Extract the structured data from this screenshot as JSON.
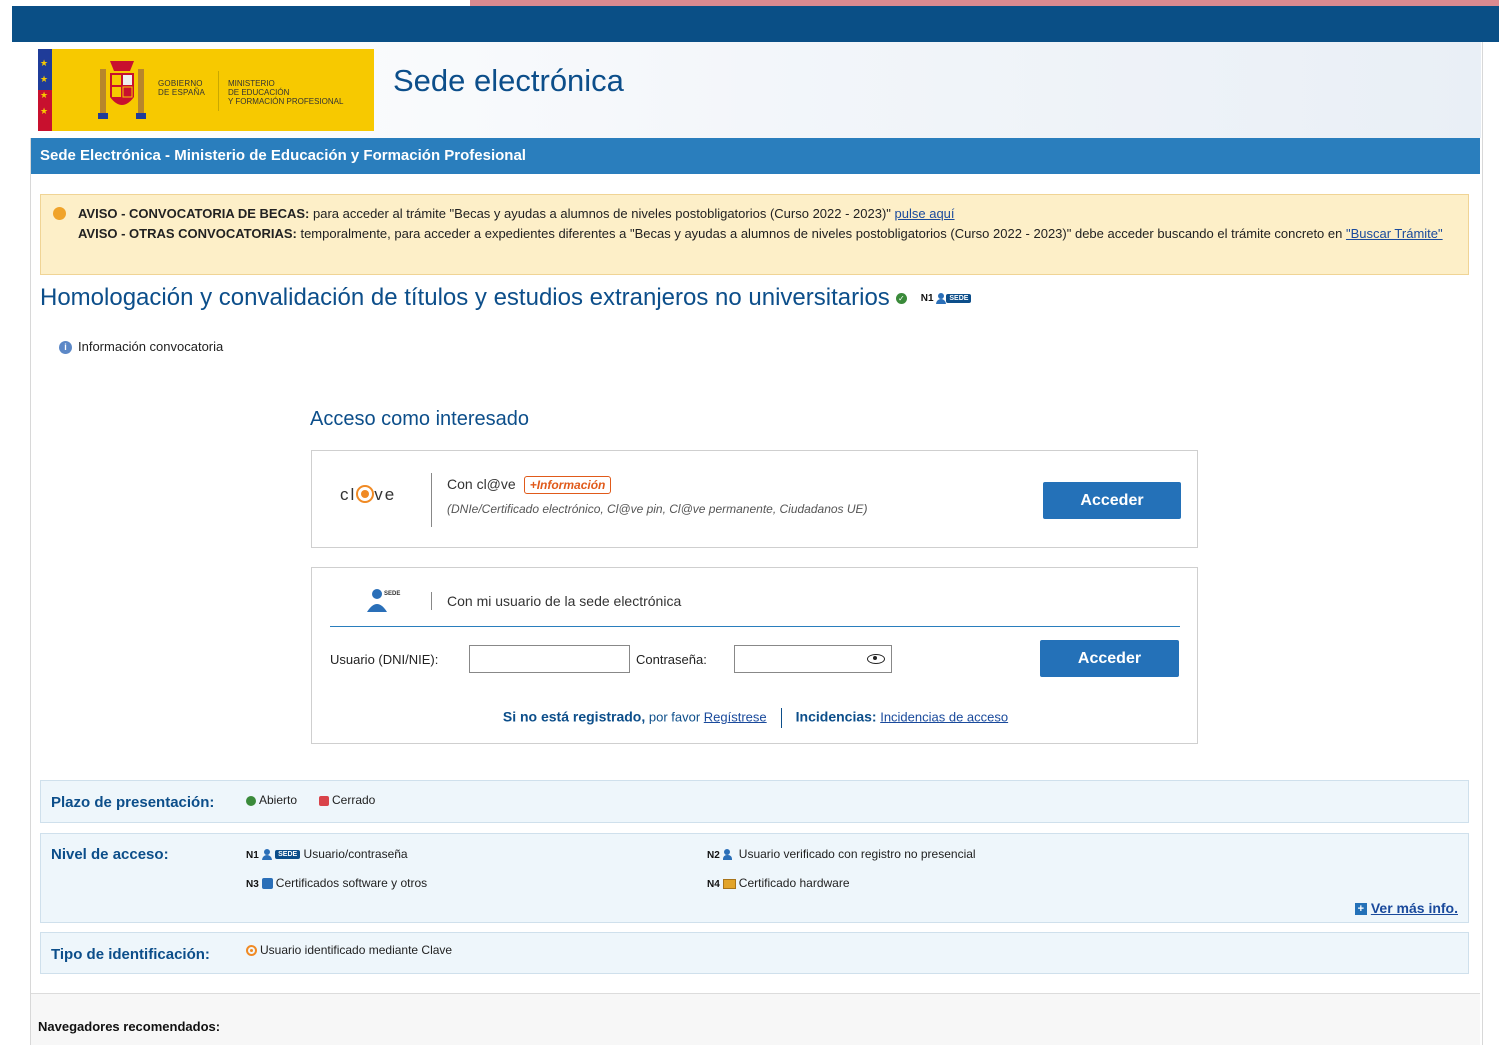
{
  "header": {
    "site_title": "Sede electrónica",
    "logo_gobierno": "GOBIERNO\nDE ESPAÑA",
    "logo_ministerio": "MINISTERIO\nDE EDUCACIÓN\nY FORMACIÓN PROFESIONAL",
    "bar_title": "Sede Electrónica - Ministerio de Educación y Formación Profesional"
  },
  "notice": {
    "line1_bold": "AVISO - CONVOCATORIA DE BECAS:",
    "line1_text": " para acceder al trámite \"Becas y ayudas a alumnos de niveles postobligatorios (Curso 2022 - 2023)\" ",
    "line1_link": "pulse aquí",
    "line2_bold": "AVISO - OTRAS CONVOCATORIAS:",
    "line2_text": " temporalmente, para acceder a expedientes diferentes a \"Becas y ayudas a alumnos de niveles postobligatorios (Curso 2022 - 2023)\" debe acceder buscando el trámite concreto en ",
    "line2_link": "\"Buscar Trámite\""
  },
  "procedure": {
    "title": "Homologación y convalidación de títulos y estudios extranjeros no universitarios",
    "level": "N1",
    "sede_badge": "SEDE",
    "info_link": "Información convocatoria"
  },
  "access": {
    "title": "Acceso como interesado",
    "clave": {
      "logo_left": "cl",
      "logo_right": "ve",
      "name": "Con cl@ve",
      "more_info": "+Información",
      "subtitle": "(DNIe/Certificado electrónico, Cl@ve pin, Cl@ve permanente, Ciudadanos UE)",
      "button": "Acceder"
    },
    "sede_user": {
      "title": "Con mi usuario de la sede electrónica",
      "sede_badge": "SEDE",
      "user_label": "Usuario (DNI/NIE):",
      "user_value": "",
      "password_label": "Contraseña:",
      "password_value": "",
      "button": "Acceder",
      "register_bold": "Si no está registrado,",
      "register_text": " por favor ",
      "register_link": "Regístrese",
      "incidents_bold": "Incidencias:",
      "incidents_link": "Incidencias de acceso"
    }
  },
  "legend": {
    "plazo": {
      "label": "Plazo de presentación:",
      "open": "Abierto",
      "closed": "Cerrado"
    },
    "nivel": {
      "label": "Nivel de acceso:",
      "items": [
        {
          "code": "N1",
          "text": "Usuario/contraseña",
          "badge": "SEDE"
        },
        {
          "code": "N2",
          "text": "Usuario verificado con registro no presencial"
        },
        {
          "code": "N3",
          "text": "Certificados software y otros"
        },
        {
          "code": "N4",
          "text": "Certificado hardware"
        }
      ],
      "more": "Ver más info."
    },
    "tipo": {
      "label": "Tipo de identificación:",
      "text": "Usuario identificado mediante Clave"
    }
  },
  "footer": {
    "browsers_title": "Navegadores recomendados:"
  },
  "colors": {
    "dark_blue": "#0a4f86",
    "bar_blue": "#2a7ebd",
    "button_blue": "#2471b8",
    "notice_bg": "#fdefc8",
    "logo_yellow": "#f7c900",
    "clave_orange": "#f08a24"
  }
}
